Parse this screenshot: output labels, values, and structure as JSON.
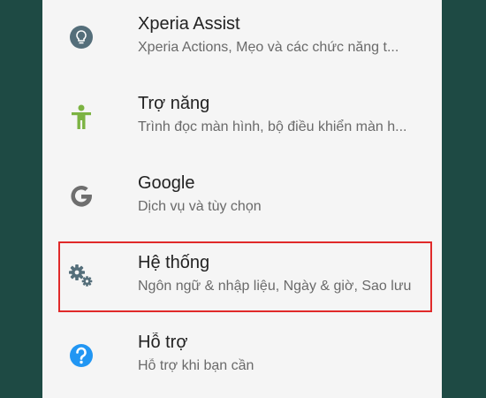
{
  "settings": {
    "items": [
      {
        "title": "Xperia Assist",
        "subtitle": "Xperia Actions, Mẹo và các chức năng t...",
        "icon": "lightbulb-icon"
      },
      {
        "title": "Trợ năng",
        "subtitle": "Trình đọc màn hình, bộ điều khiển màn h...",
        "icon": "accessibility-icon"
      },
      {
        "title": "Google",
        "subtitle": "Dịch vụ và tùy chọn",
        "icon": "google-icon"
      },
      {
        "title": "Hệ thống",
        "subtitle": "Ngôn ngữ & nhập liệu, Ngày & giờ, Sao lưu",
        "icon": "gears-icon",
        "highlighted": true
      },
      {
        "title": "Hỗ trợ",
        "subtitle": "Hỗ trợ khi bạn cần",
        "icon": "help-icon"
      }
    ]
  },
  "colors": {
    "background": "#1e4a44",
    "panel": "#f5f5f5",
    "highlight_border": "#e02a2a",
    "accessibility_green": "#7cb342",
    "help_blue": "#2196f3",
    "icon_gray": "#546e7a"
  }
}
